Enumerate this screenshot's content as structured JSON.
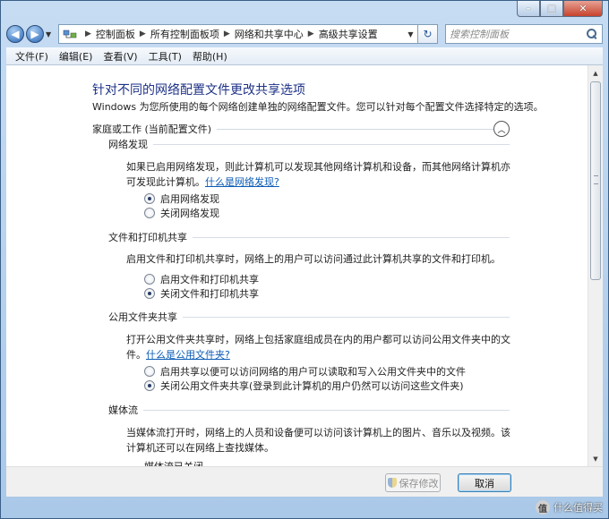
{
  "window": {
    "caption_buttons": [
      "minimize",
      "maximize",
      "close"
    ]
  },
  "address_bar": {
    "crumbs": [
      "控制面板",
      "所有控制面板项",
      "网络和共享中心",
      "高级共享设置"
    ],
    "search_placeholder": "搜索控制面板"
  },
  "menu": {
    "items": [
      "文件(F)",
      "编辑(E)",
      "查看(V)",
      "工具(T)",
      "帮助(H)"
    ]
  },
  "page": {
    "title": "针对不同的网络配置文件更改共享选项",
    "description": "Windows 为您所使用的每个网络创建单独的网络配置文件。您可以针对每个配置文件选择特定的选项。",
    "profile": "家庭或工作 (当前配置文件)"
  },
  "sections": {
    "discovery": {
      "heading": "网络发现",
      "text": "如果已启用网络发现，则此计算机可以发现其他网络计算机和设备，而其他网络计算机亦可发现此计算机。",
      "link": "什么是网络发现?",
      "options": [
        "启用网络发现",
        "关闭网络发现"
      ],
      "selected": 0
    },
    "file_printer": {
      "heading": "文件和打印机共享",
      "text": "启用文件和打印机共享时，网络上的用户可以访问通过此计算机共享的文件和打印机。",
      "options": [
        "启用文件和打印机共享",
        "关闭文件和打印机共享"
      ],
      "selected": 1
    },
    "public_folder": {
      "heading": "公用文件夹共享",
      "text": "打开公用文件夹共享时，网络上包括家庭组成员在内的用户都可以访问公用文件夹中的文件。",
      "link": "什么是公用文件夹?",
      "options": [
        "启用共享以便可以访问网络的用户可以读取和写入公用文件夹中的文件",
        "关闭公用文件夹共享(登录到此计算机的用户仍然可以访问这些文件夹)"
      ],
      "selected": 1
    },
    "media": {
      "heading": "媒体流",
      "text": "当媒体流打开时，网络上的人员和设备便可以访问该计算机上的图片、音乐以及视频。该计算机还可以在网络上查找媒体。",
      "status": "媒体流已关闭"
    }
  },
  "buttons": {
    "save": "保存修改",
    "cancel": "取消"
  },
  "watermark": {
    "text": "什么值得买",
    "icon_text": "值"
  }
}
